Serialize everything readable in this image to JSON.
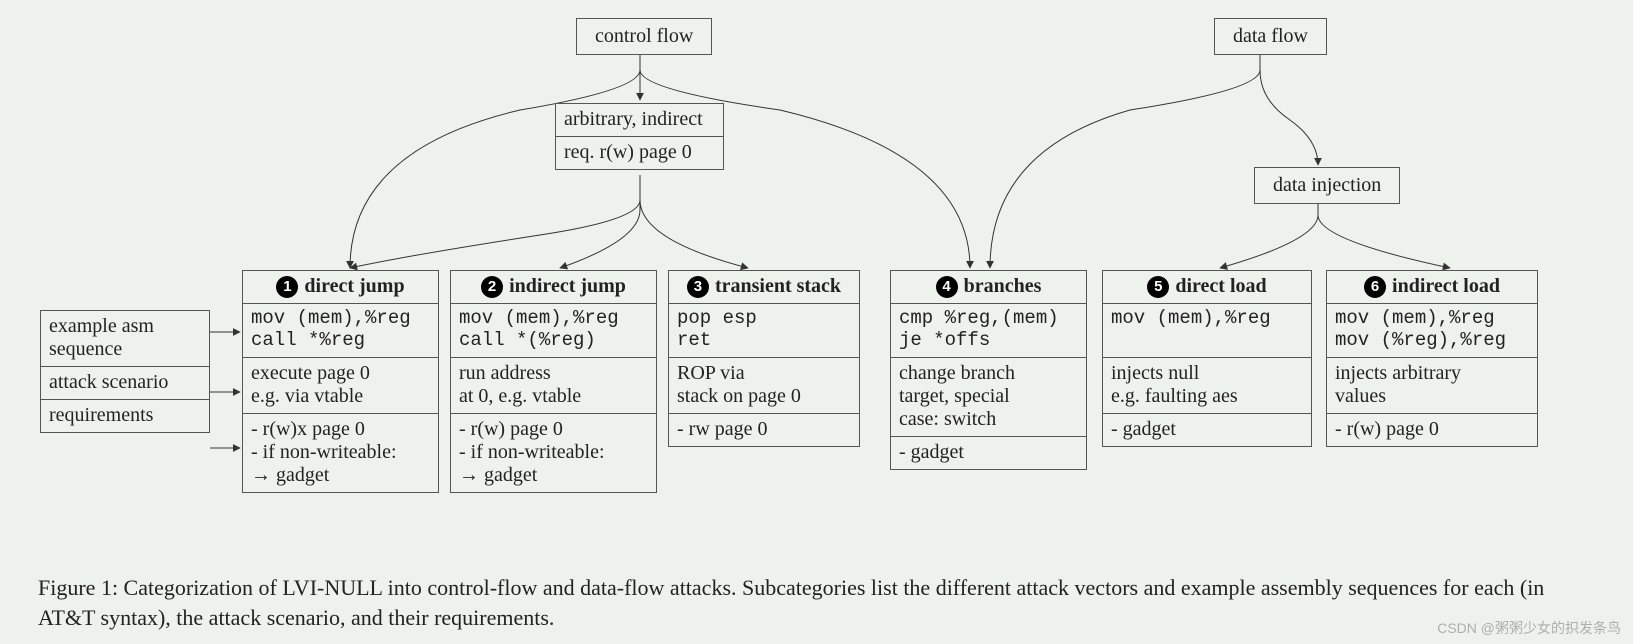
{
  "top": {
    "control_flow": "control flow",
    "data_flow": "data flow",
    "arb_ind": "arbitrary, indirect",
    "arb_req": "req. r(w) page 0",
    "data_inj": "data injection"
  },
  "rowlabels": {
    "asm": "example asm sequence",
    "attack": "attack scenario",
    "req": "requirements"
  },
  "cols": {
    "c1": {
      "num": "1",
      "title": "direct jump",
      "asm": "mov (mem),%reg\ncall *%reg",
      "attack": "execute page 0\ne.g. via vtable",
      "req": "- r(w)x page 0\n- if non-writeable:\n→ gadget"
    },
    "c2": {
      "num": "2",
      "title": "indirect jump",
      "asm": "mov (mem),%reg\ncall *(%reg)",
      "attack": "run address\nat 0, e.g. vtable",
      "req": "- r(w) page 0\n- if non-writeable:\n→ gadget"
    },
    "c3": {
      "num": "3",
      "title": "transient stack",
      "asm": "pop esp\nret",
      "attack": "ROP via\nstack on page 0",
      "req": "- rw page 0"
    },
    "c4": {
      "num": "4",
      "title": "branches",
      "asm": "cmp %reg,(mem)\nje *offs",
      "attack": "change branch\ntarget, special\ncase: switch",
      "req": "- gadget"
    },
    "c5": {
      "num": "5",
      "title": "direct load",
      "asm": "mov (mem),%reg",
      "attack": "injects null\ne.g. faulting aes",
      "req": "- gadget"
    },
    "c6": {
      "num": "6",
      "title": "indirect load",
      "asm": "mov (mem),%reg\nmov (%reg),%reg",
      "attack": "injects arbitrary\nvalues",
      "req": "- r(w) page 0"
    }
  },
  "caption": "Figure 1: Categorization of LVI-NULL into control-flow and data-flow attacks. Subcategories list the different attack vectors and example assembly sequences for each (in AT&T syntax), the attack scenario, and their requirements.",
  "watermark": "CSDN @粥粥少女的抧发条鸟"
}
